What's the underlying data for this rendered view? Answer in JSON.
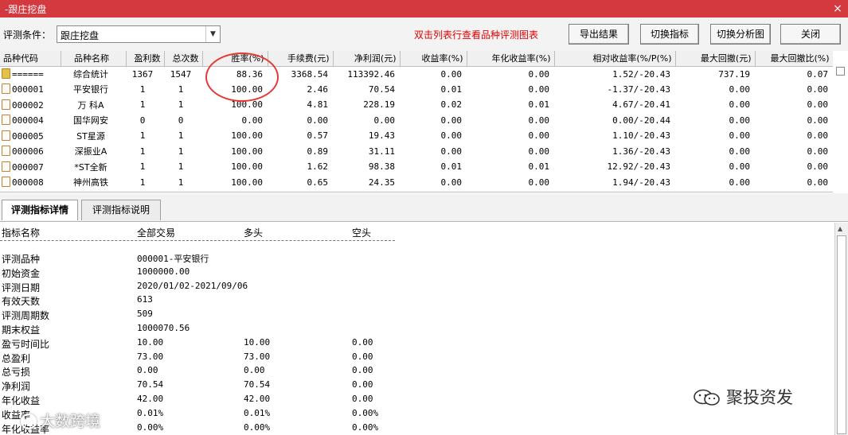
{
  "window": {
    "title": "-跟庄挖盘",
    "close_glyph": "×"
  },
  "toolbar": {
    "label": "评测条件：",
    "selected": "跟庄挖盘",
    "hint": "双击列表行查看品种评测图表",
    "buttons": [
      "导出结果",
      "切换指标",
      "切换分析图",
      "关闭"
    ]
  },
  "grid": {
    "headers": [
      "品种代码",
      "品种名称",
      "盈利数",
      "总次数",
      "胜率(%)",
      "手续费(元)",
      "净利润(元)",
      "收益率(%)",
      "年化收益率(%)",
      "相对收益率(%/P(%)",
      "最大回撤(元)",
      "最大回撤比(%)"
    ],
    "rows": [
      [
        "======",
        "综合统计",
        "1367",
        "1547",
        "88.36",
        "3368.54",
        "113392.46",
        "0.00",
        "0.00",
        "1.52/-20.43",
        "737.19",
        "0.07"
      ],
      [
        "000001",
        "平安银行",
        "1",
        "1",
        "100.00",
        "2.46",
        "70.54",
        "0.01",
        "0.00",
        "-1.37/-20.43",
        "0.00",
        "0.00"
      ],
      [
        "000002",
        "万 科A",
        "1",
        "1",
        "100.00",
        "4.81",
        "228.19",
        "0.02",
        "0.01",
        "4.67/-20.41",
        "0.00",
        "0.00"
      ],
      [
        "000004",
        "国华网安",
        "0",
        "0",
        "0.00",
        "0.00",
        "0.00",
        "0.00",
        "0.00",
        "0.00/-20.44",
        "0.00",
        "0.00"
      ],
      [
        "000005",
        "ST星源",
        "1",
        "1",
        "100.00",
        "0.57",
        "19.43",
        "0.00",
        "0.00",
        "1.10/-20.43",
        "0.00",
        "0.00"
      ],
      [
        "000006",
        "深振业A",
        "1",
        "1",
        "100.00",
        "0.89",
        "31.11",
        "0.00",
        "0.00",
        "1.36/-20.43",
        "0.00",
        "0.00"
      ],
      [
        "000007",
        "*ST全新",
        "1",
        "1",
        "100.00",
        "1.62",
        "98.38",
        "0.01",
        "0.01",
        "12.92/-20.43",
        "0.00",
        "0.00"
      ],
      [
        "000008",
        "神州高铁",
        "1",
        "1",
        "100.00",
        "0.65",
        "24.35",
        "0.00",
        "0.00",
        "1.94/-20.43",
        "0.00",
        "0.00"
      ]
    ]
  },
  "tabs": [
    "评测指标详情",
    "评测指标说明"
  ],
  "detail": {
    "headers": [
      "指标名称",
      "全部交易",
      "多头",
      "空头"
    ],
    "rows": [
      [
        "评测品种",
        "000001-平安银行",
        "",
        ""
      ],
      [
        "初始资金",
        "1000000.00",
        "",
        ""
      ],
      [
        "评测日期",
        "2020/01/02-2021/09/06",
        "",
        ""
      ],
      [
        "有效天数",
        "613",
        "",
        ""
      ],
      [
        "评测周期数",
        "509",
        "",
        ""
      ],
      [
        "期末权益",
        "1000070.56",
        "",
        ""
      ],
      [
        "盈亏时间比",
        "10.00",
        "10.00",
        "0.00"
      ],
      [
        "总盈利",
        "73.00",
        "73.00",
        "0.00"
      ],
      [
        "总亏损",
        "0.00",
        "0.00",
        "0.00"
      ],
      [
        "净利润",
        "70.54",
        "70.54",
        "0.00"
      ],
      [
        "年化收益",
        "42.00",
        "42.00",
        "0.00"
      ],
      [
        "收益率",
        "0.01%",
        "0.01%",
        "0.00%"
      ],
      [
        "年化收益率",
        "0.00%",
        "0.00%",
        "0.00%"
      ]
    ]
  },
  "watermarks": {
    "left": "大数跨境",
    "right": "聚投资发"
  }
}
